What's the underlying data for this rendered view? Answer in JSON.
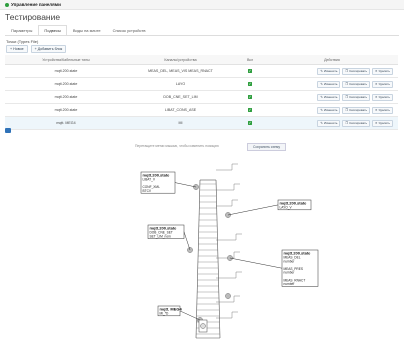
{
  "header": {
    "breadcrumb": "Управление панелями",
    "title": "Тестирование"
  },
  "tabs": [
    {
      "label": "Параметры",
      "active": false
    },
    {
      "label": "Подвесы",
      "active": true
    },
    {
      "label": "Виды на мачте",
      "active": false
    },
    {
      "label": "Список устройств",
      "active": false
    }
  ],
  "section": {
    "label": "Точки (Types File)"
  },
  "buttons": {
    "new": "Новое",
    "add_group": "Добавить блок"
  },
  "table": {
    "headers": [
      "Устройства/Кабельные типы",
      "Каналы/устройства",
      "Вкл",
      "Действия"
    ],
    "rows": [
      {
        "device": "mqtt.200.state",
        "channels": "MEAS_DEL, MEAS_VIS MEAS_RNACT",
        "enabled": true,
        "highlight": false
      },
      {
        "device": "mqtt.200.state",
        "channels": "LAYO",
        "enabled": true,
        "highlight": false
      },
      {
        "device": "mqtt.200.state",
        "channels": "DOB_CNE_SET_LIM",
        "enabled": true,
        "highlight": false
      },
      {
        "device": "mqtt.200.state",
        "channels": "LIBAT_CONS_ASE",
        "enabled": true,
        "highlight": false
      },
      {
        "device": "mqtt. MEG4",
        "channels": "MI",
        "enabled": true,
        "highlight": true
      }
    ],
    "actions": {
      "edit": "Изменить",
      "copy": "Скопировать",
      "delete": "Удалить"
    }
  },
  "save": {
    "hint": "Перетащите метки мышью, чтобы изменить позицию",
    "button": "Сохранить схему"
  },
  "diagram": {
    "boxes": [
      {
        "title": "mqtt.200.state",
        "lines": [
          "LIBAT_V",
          "",
          "CONF_XML",
          "BTCV"
        ]
      },
      {
        "title": "mqtt.200.state",
        "lines": [
          "LAYO_V"
        ]
      },
      {
        "title": "mqtt.200.state",
        "lines": [
          "DOB_CNE_SET",
          "SET_LIM_nom"
        ]
      },
      {
        "title": "mqtt.200.state",
        "lines": [
          "MEAS_DEL",
          "number",
          "",
          "MEAS_PRES",
          "number",
          "",
          "MEAS_RNACT",
          "number"
        ]
      },
      {
        "title": "mqtt. MEG4",
        "lines": [
          "MI_*D"
        ]
      }
    ]
  }
}
